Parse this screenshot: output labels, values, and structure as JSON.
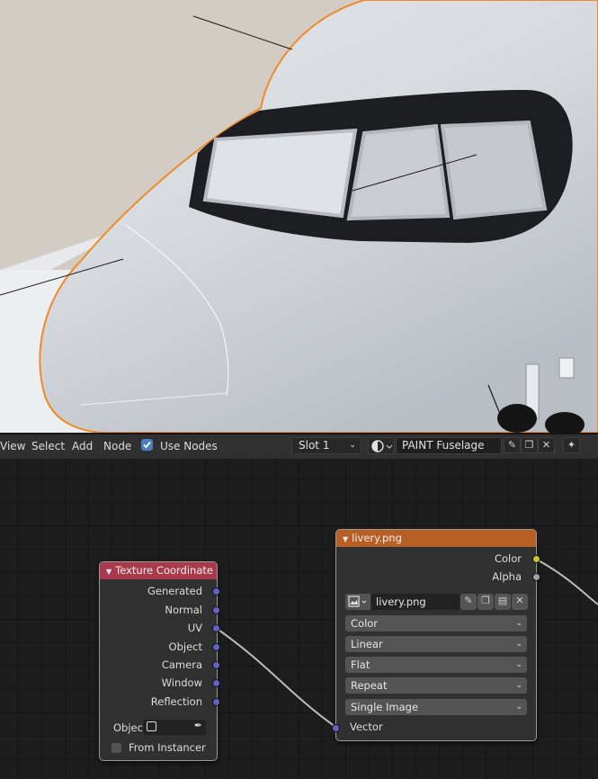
{
  "header": {
    "menu": [
      "View",
      "Select",
      "Add",
      "Node"
    ],
    "use_nodes_label": "Use Nodes",
    "use_nodes_checked": true,
    "slot": "Slot 1",
    "material_name": "PAINT Fuselage",
    "icons": [
      "material-sphere-icon",
      "fake-user-icon",
      "duplicate-icon",
      "unlink-icon",
      "pin-icon"
    ]
  },
  "nodes": {
    "texture_coordinate": {
      "title": "Texture Coordinate",
      "header_color": "#a83a4c",
      "outputs": [
        "Generated",
        "Normal",
        "UV",
        "Object",
        "Camera",
        "Window",
        "Reflection"
      ],
      "object_label": "Objec",
      "from_instancer_label": "From Instancer"
    },
    "image_texture": {
      "title": "livery.png",
      "header_color": "#b85f26",
      "outputs": [
        "Color",
        "Alpha"
      ],
      "image_name": "livery.png",
      "color_space": "Color",
      "interpolation": "Linear",
      "projection": "Flat",
      "extension": "Repeat",
      "source": "Single Image",
      "input": "Vector"
    }
  },
  "colors": {
    "accent": "#4a7fc4",
    "socket_vector": "#6363c7",
    "socket_color": "#c7c729",
    "socket_float": "#a1a1a1",
    "selection": "#f08a24"
  }
}
